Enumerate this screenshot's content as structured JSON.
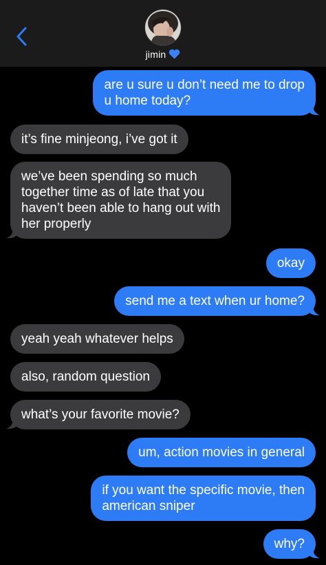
{
  "header": {
    "contact_name": "jimin",
    "heart_emoji": "💙",
    "back_icon": "chevron-left-icon",
    "avatar_icon": "contact-avatar"
  },
  "colors": {
    "background": "#000000",
    "header": "#1b1b1b",
    "incoming_bubble": "#3b3b3d",
    "outgoing_bubble": "#2d7cf6",
    "accent": "#2d7cf6"
  },
  "messages": [
    {
      "side": "out",
      "lines": [
        "are u sure u don’t need me to drop",
        "u home today?"
      ]
    },
    {
      "side": "in",
      "lines": [
        "it’s fine minjeong, i’ve got it"
      ]
    },
    {
      "side": "in",
      "lines": [
        "we’ve been spending so much",
        "together time as of late that you",
        "haven’t been able to hang out with",
        "her properly"
      ]
    },
    {
      "side": "out",
      "lines": [
        "okay"
      ]
    },
    {
      "side": "out",
      "lines": [
        "send me a text when ur home?"
      ]
    },
    {
      "side": "in",
      "lines": [
        "yeah yeah whatever helps"
      ]
    },
    {
      "side": "in",
      "lines": [
        "also, random question"
      ]
    },
    {
      "side": "in",
      "lines": [
        "what’s your favorite movie?"
      ]
    },
    {
      "side": "out",
      "lines": [
        "um, action movies in general"
      ]
    },
    {
      "side": "out",
      "lines": [
        "if you want the specific movie, then",
        "american sniper"
      ]
    },
    {
      "side": "out",
      "lines": [
        "why?"
      ]
    }
  ]
}
